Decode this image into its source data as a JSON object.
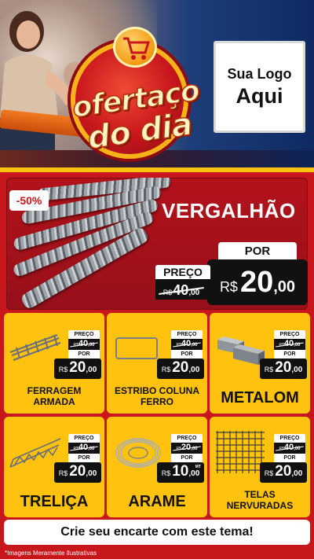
{
  "hero": {
    "badge_line1": "ofertaço",
    "badge_line2": "do dia",
    "logo_line1": "Sua Logo",
    "logo_line2": "Aqui"
  },
  "featured": {
    "discount": "-50%",
    "title": "VERGALHÃO",
    "preco_label": "PREÇO",
    "old_currency": "R$",
    "old_int": "40",
    "old_dec": ",00",
    "por_label": "POR",
    "currency": "R$",
    "price_int": "20",
    "price_dec": ",00"
  },
  "products": [
    {
      "name": "FERRAGEM ARMADA",
      "preco_label": "PREÇO",
      "old_currency": "R$",
      "old_int": "40",
      "old_dec": ",00",
      "por_label": "POR",
      "currency": "R$",
      "price_int": "20",
      "price_dec": ",00"
    },
    {
      "name": "ESTRIBO COLUNA FERRO",
      "preco_label": "PREÇO",
      "old_currency": "R$",
      "old_int": "40",
      "old_dec": ",00",
      "por_label": "POR",
      "currency": "R$",
      "price_int": "20",
      "price_dec": ",00"
    },
    {
      "name": "METALOM",
      "preco_label": "PREÇO",
      "old_currency": "R$",
      "old_int": "40",
      "old_dec": ",00",
      "por_label": "POR",
      "currency": "R$",
      "price_int": "20",
      "price_dec": ",00"
    },
    {
      "name": "TRELIÇA",
      "preco_label": "PREÇO",
      "old_currency": "R$",
      "old_int": "40",
      "old_dec": ",00",
      "por_label": "POR",
      "currency": "R$",
      "price_int": "20",
      "price_dec": ",00"
    },
    {
      "name": "ARAME",
      "preco_label": "PREÇO",
      "old_currency": "R$",
      "old_int": "20",
      "old_dec": ",00",
      "por_label": "POR",
      "currency": "R$",
      "price_int": "10",
      "price_dec": ",00",
      "unit": "MT"
    },
    {
      "name": "TELAS NERVURADAS",
      "preco_label": "PREÇO",
      "old_currency": "R$",
      "old_int": "40",
      "old_dec": ",00",
      "por_label": "POR",
      "currency": "R$",
      "price_int": "20",
      "price_dec": ",00"
    }
  ],
  "cta": "Crie seu encarte com este tema!",
  "disclaimer": "*Imagens Meramente Ilustrativas",
  "colors": {
    "red": "#c8161d",
    "yellow": "#ffc20e",
    "black": "#111111",
    "white": "#ffffff"
  }
}
